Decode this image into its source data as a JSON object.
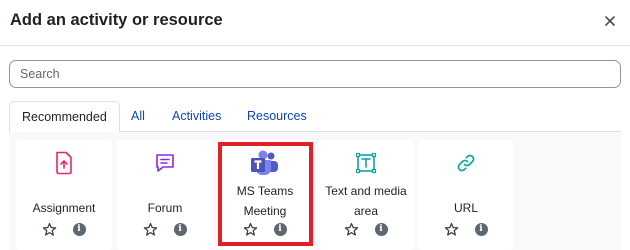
{
  "dialog": {
    "title": "Add an activity or resource",
    "close_label": "×"
  },
  "search": {
    "placeholder": "Search",
    "value": ""
  },
  "tabs": [
    {
      "label": "Recommended",
      "active": true
    },
    {
      "label": "All",
      "active": false
    },
    {
      "label": "Activities",
      "active": false
    },
    {
      "label": "Resources",
      "active": false
    }
  ],
  "modules": [
    {
      "label": "Assignment",
      "icon": "assignment-upload-icon",
      "icon_color": "#e8246f"
    },
    {
      "label": "Forum",
      "icon": "forum-chat-icon",
      "icon_color": "#8a2be2"
    },
    {
      "label": "MS Teams Meeting",
      "icon": "ms-teams-icon",
      "icon_color": "#5059c9",
      "highlighted": true
    },
    {
      "label": "Text and media area",
      "icon": "text-media-icon",
      "icon_color": "#11a3a3"
    },
    {
      "label": "URL",
      "icon": "link-icon",
      "icon_color": "#11a3a3"
    }
  ],
  "highlight_color": "#e21f26"
}
